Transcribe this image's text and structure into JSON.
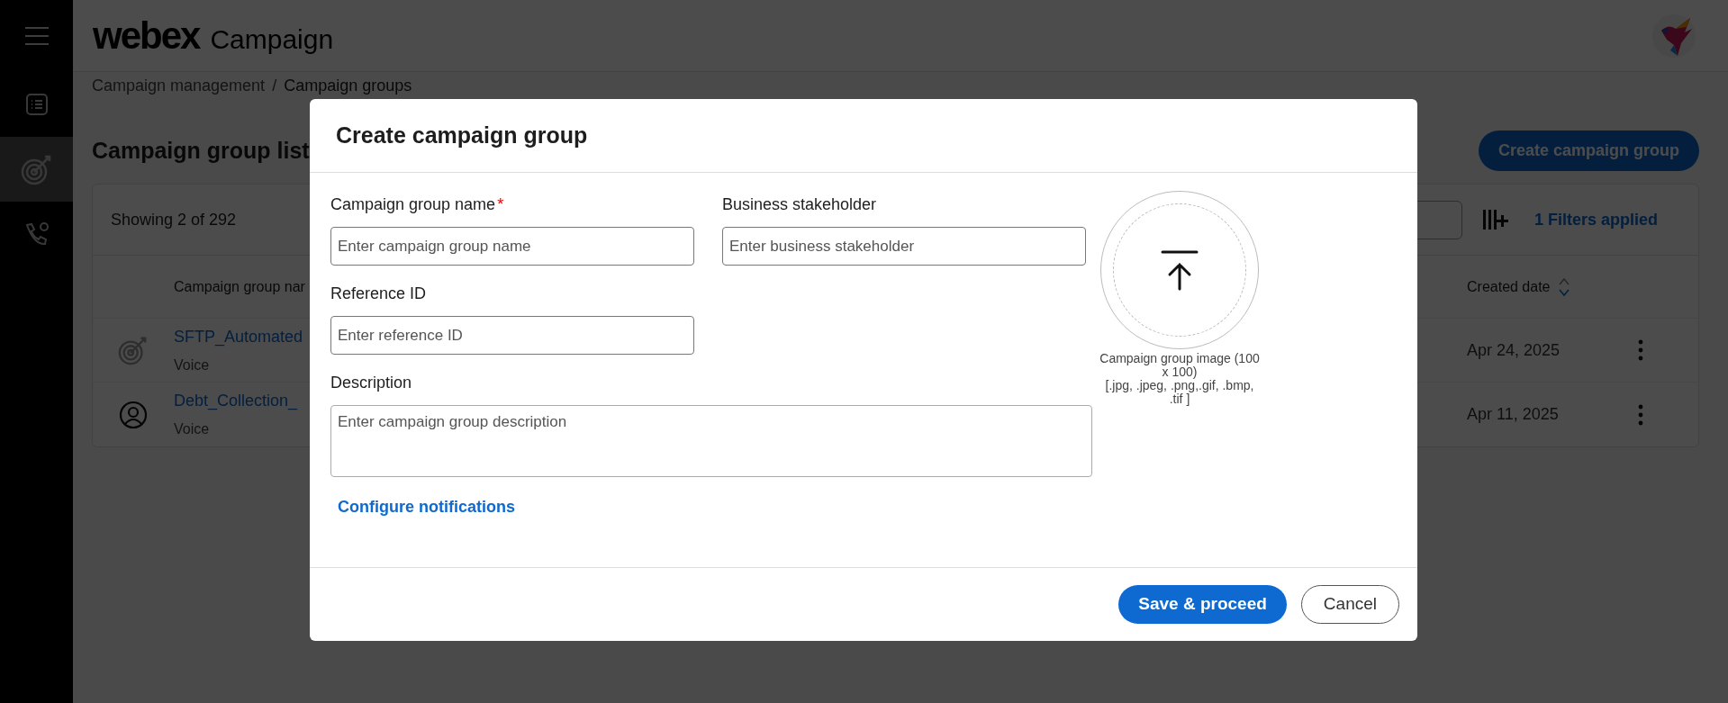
{
  "app": {
    "logo": "webex",
    "title": "Campaign"
  },
  "sidebar": {
    "items": [
      {
        "kind": "list",
        "selected": false
      },
      {
        "kind": "target",
        "selected": true
      },
      {
        "kind": "phone",
        "selected": false
      }
    ]
  },
  "breadcrumb": {
    "items": [
      "Campaign management",
      "Campaign groups"
    ],
    "separator": "/"
  },
  "page": {
    "title": "Campaign group list",
    "create_button": "Create campaign group"
  },
  "table": {
    "showing": "Showing 2 of 292",
    "filters": "1 Filters applied",
    "columns": [
      {
        "label": "Campaign group nar"
      },
      {
        "label": "Created date"
      }
    ],
    "rows": [
      {
        "kind": "target",
        "name": "SFTP_Automated",
        "channel": "Voice",
        "created": "Apr 24, 2025"
      },
      {
        "kind": "person",
        "name": "Debt_Collection_",
        "channel": "Voice",
        "created": "Apr 11, 2025"
      }
    ]
  },
  "modal": {
    "title": "Create campaign group",
    "fields": [
      {
        "label": "Campaign group name",
        "required_mark": "*",
        "placeholder": "Enter campaign group name"
      },
      {
        "label": "Business stakeholder",
        "placeholder": "Enter business stakeholder"
      },
      {
        "label": "Reference ID",
        "placeholder": "Enter reference ID"
      },
      {
        "label": "Description",
        "placeholder": "Enter campaign group description"
      }
    ],
    "image_caption": [
      "Campaign group image (100 x 100)",
      "[.jpg, .jpeg, .png,.gif, .bmp, .tif ]"
    ],
    "link": "Configure notifications",
    "buttons": [
      {
        "kind": "primary",
        "label": "Save & proceed"
      },
      {
        "kind": "secondary",
        "label": "Cancel"
      }
    ]
  }
}
